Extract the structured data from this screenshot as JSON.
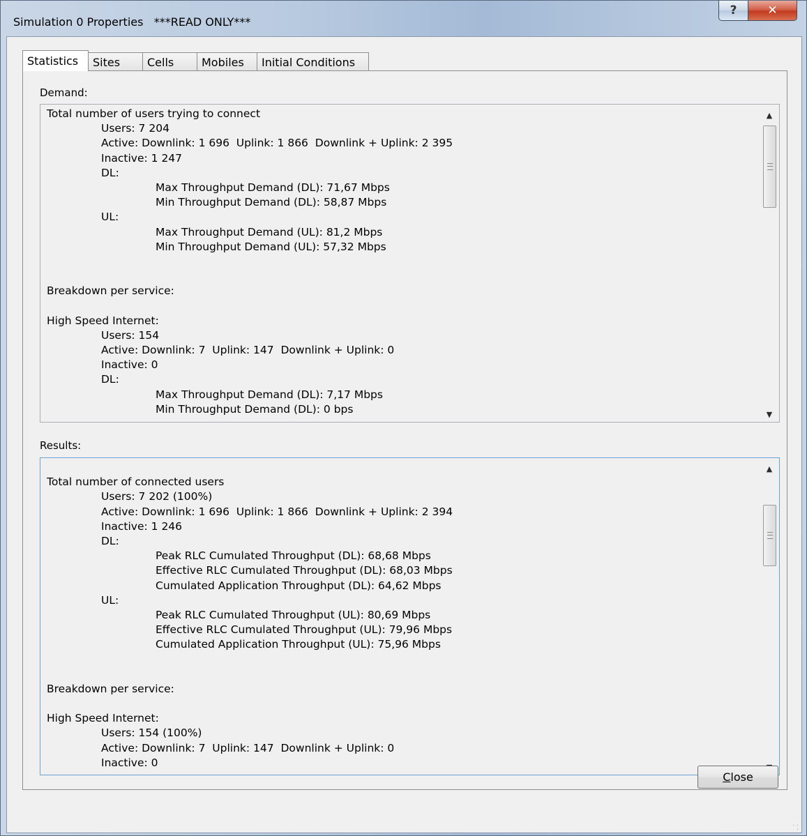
{
  "window": {
    "title": "Simulation 0 Properties   ***READ ONLY***",
    "help_glyph": "?",
    "close_glyph": "✕"
  },
  "tabs": [
    {
      "label": "Statistics",
      "active": true
    },
    {
      "label": "Sites",
      "active": false
    },
    {
      "label": "Cells",
      "active": false
    },
    {
      "label": "Mobiles",
      "active": false
    },
    {
      "label": "Initial Conditions",
      "active": false
    }
  ],
  "demand": {
    "label": "Demand:",
    "lines": [
      "Total number of users trying to connect",
      "Users: 7 204",
      "Active: Downlink: 1 696  Uplink: 1 866  Downlink + Uplink: 2 395",
      "Inactive: 1 247",
      "DL:",
      "Max Throughput Demand (DL): 71,67 Mbps",
      "Min Throughput Demand (DL): 58,87 Mbps",
      "UL:",
      "Max Throughput Demand (UL): 81,2 Mbps",
      "Min Throughput Demand (UL): 57,32 Mbps",
      "",
      "",
      "Breakdown per service:",
      "",
      "High Speed Internet:",
      "Users: 154",
      "Active: Downlink: 7  Uplink: 147  Downlink + Uplink: 0",
      "Inactive: 0",
      "DL:",
      "Max Throughput Demand (DL): 7,17 Mbps",
      "Min Throughput Demand (DL): 0 bps"
    ]
  },
  "results": {
    "label": "Results:",
    "lines": [
      "",
      "Total number of connected users",
      "Users: 7 202 (100%)",
      "Active: Downlink: 1 696  Uplink: 1 866  Downlink + Uplink: 2 394",
      "Inactive: 1 246",
      "DL:",
      "Peak RLC Cumulated Throughput (DL): 68,68 Mbps",
      "Effective RLC Cumulated Throughput (DL): 68,03 Mbps",
      "Cumulated Application Throughput (DL): 64,62 Mbps",
      "UL:",
      "Peak RLC Cumulated Throughput (UL): 80,69 Mbps",
      "Effective RLC Cumulated Throughput (UL): 79,96 Mbps",
      "Cumulated Application Throughput (UL): 75,96 Mbps",
      "",
      "",
      "Breakdown per service:",
      "",
      "High Speed Internet:",
      "Users: 154 (100%)",
      "Active: Downlink: 7  Uplink: 147  Downlink + Uplink: 0",
      "Inactive: 0"
    ]
  },
  "buttons": {
    "close_label_first": "C",
    "close_label_rest": "lose"
  },
  "scrollbar": {
    "up_glyph": "▲",
    "down_glyph": "▼"
  }
}
